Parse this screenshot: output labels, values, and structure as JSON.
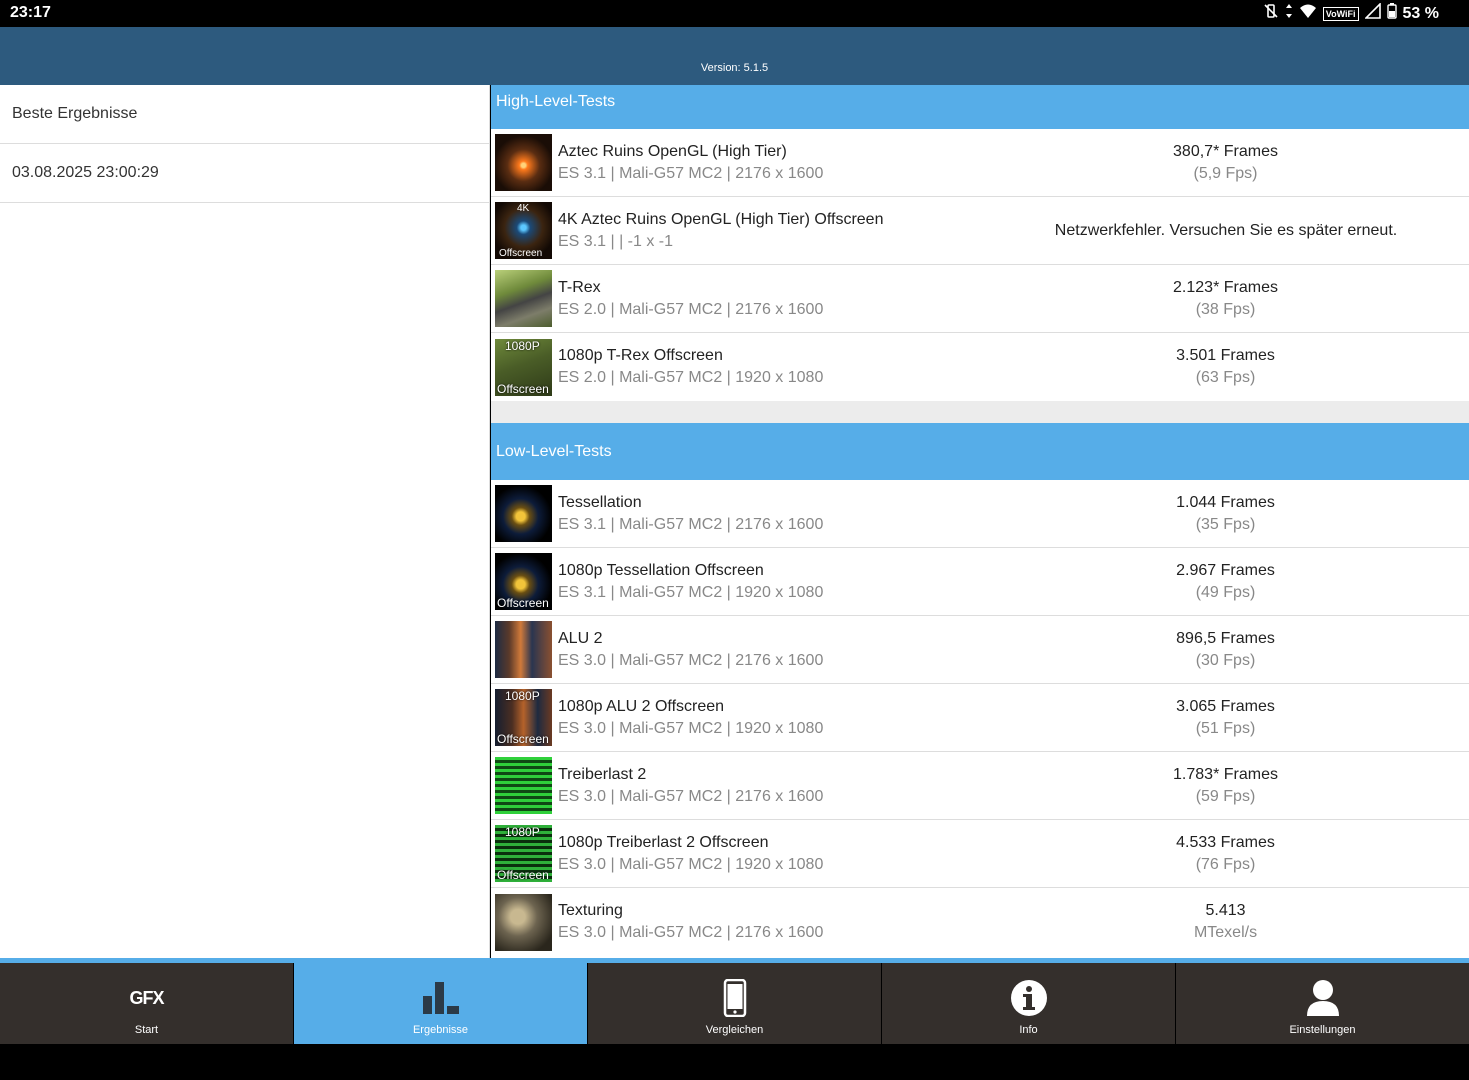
{
  "status_bar": {
    "time": "23:17",
    "vowifi": "VoWiFi",
    "battery": "53 %",
    "icons": [
      "vibrate-off-icon",
      "data-arrows-icon",
      "wifi-icon",
      "vowifi-icon",
      "signal-icon",
      "battery-icon"
    ]
  },
  "header": {
    "version": "Version: 5.1.5"
  },
  "left_panel": {
    "title": "Beste Ergebnisse",
    "date": "03.08.2025 23:00:29"
  },
  "high_level": {
    "title": "High-Level-Tests",
    "rows": [
      {
        "name": "Aztec Ruins OpenGL (High Tier)",
        "sub": "ES 3.1 | Mali-G57 MC2 | 2176 x 1600",
        "frames": "380,7* Frames",
        "fps": "(5,9 Fps)"
      },
      {
        "name": "4K Aztec Ruins OpenGL (High Tier) Offscreen",
        "sub": "ES 3.1 |  | -1 x -1",
        "error": "Netzwerkfehler. Versuchen Sie es später erneut.",
        "thumb_top": "4K",
        "thumb_bottom": "Offscreen"
      },
      {
        "name": "T-Rex",
        "sub": "ES 2.0 | Mali-G57 MC2 | 2176 x 1600",
        "frames": "2.123* Frames",
        "fps": "(38 Fps)"
      },
      {
        "name": "1080p T-Rex Offscreen",
        "sub": "ES 2.0 | Mali-G57 MC2 | 1920 x 1080",
        "frames": "3.501 Frames",
        "fps": "(63 Fps)",
        "thumb_top": "1080P",
        "thumb_bottom": "Offscreen"
      }
    ]
  },
  "low_level": {
    "title": "Low-Level-Tests",
    "rows": [
      {
        "name": "Tessellation",
        "sub": "ES 3.1 | Mali-G57 MC2 | 2176 x 1600",
        "frames": "1.044 Frames",
        "fps": "(35 Fps)"
      },
      {
        "name": "1080p Tessellation Offscreen",
        "sub": "ES 3.1 | Mali-G57 MC2 | 1920 x 1080",
        "frames": "2.967 Frames",
        "fps": "(49 Fps)",
        "thumb_bottom": "Offscreen"
      },
      {
        "name": "ALU 2",
        "sub": "ES 3.0 | Mali-G57 MC2 | 2176 x 1600",
        "frames": "896,5 Frames",
        "fps": "(30 Fps)"
      },
      {
        "name": "1080p ALU 2 Offscreen",
        "sub": "ES 3.0 | Mali-G57 MC2 | 1920 x 1080",
        "frames": "3.065 Frames",
        "fps": "(51 Fps)",
        "thumb_top": "1080P",
        "thumb_bottom": "Offscreen"
      },
      {
        "name": "Treiberlast 2",
        "sub": "ES 3.0 | Mali-G57 MC2 | 2176 x 1600",
        "frames": "1.783* Frames",
        "fps": "(59 Fps)"
      },
      {
        "name": "1080p Treiberlast 2 Offscreen",
        "sub": "ES 3.0 | Mali-G57 MC2 | 1920 x 1080",
        "frames": "4.533 Frames",
        "fps": "(76 Fps)",
        "thumb_top": "1080P",
        "thumb_bottom": "Offscreen"
      },
      {
        "name": "Texturing",
        "sub": "ES 3.0 | Mali-G57 MC2 | 2176 x 1600",
        "frames": "5.413",
        "fps": "MTexel/s"
      }
    ]
  },
  "nav": {
    "items": [
      {
        "label": "Start",
        "icon": "gfx-logo-icon",
        "icon_text": "GFX"
      },
      {
        "label": "Ergebnisse",
        "icon": "bar-chart-icon",
        "active": true
      },
      {
        "label": "Vergleichen",
        "icon": "phone-icon"
      },
      {
        "label": "Info",
        "icon": "info-icon"
      },
      {
        "label": "Einstellungen",
        "icon": "person-icon"
      }
    ]
  },
  "colors": {
    "appbar": "#2d5a7e",
    "section_header": "#56ade8",
    "nav_bg": "#342f2c",
    "nav_active": "#56ade8"
  }
}
